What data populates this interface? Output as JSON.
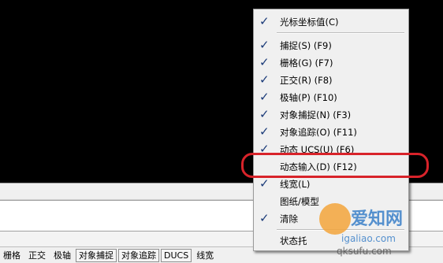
{
  "statusbar": {
    "buttons": [
      {
        "label": "栅格",
        "pressed": false
      },
      {
        "label": "正交",
        "pressed": false
      },
      {
        "label": "极轴",
        "pressed": false
      },
      {
        "label": "对象捕捉",
        "pressed": true
      },
      {
        "label": "对象追踪",
        "pressed": true
      },
      {
        "label": "DUCS",
        "pressed": true
      },
      {
        "label": "线宽",
        "pressed": false
      }
    ]
  },
  "context_menu": {
    "items": [
      {
        "label": "光标坐标值(C)",
        "checked": true
      },
      {
        "label": "捕捉(S) (F9)",
        "checked": true
      },
      {
        "label": "栅格(G) (F7)",
        "checked": true
      },
      {
        "label": "正交(R) (F8)",
        "checked": true
      },
      {
        "label": "极轴(P) (F10)",
        "checked": true
      },
      {
        "label": "对象捕捉(N) (F3)",
        "checked": true
      },
      {
        "label": "对象追踪(O) (F11)",
        "checked": true
      },
      {
        "label": "动态 UCS(U) (F6)",
        "checked": true
      },
      {
        "label": "动态输入(D) (F12)",
        "checked": false
      },
      {
        "label": "线宽(L)",
        "checked": true
      },
      {
        "label": "图纸/模型",
        "checked": false
      },
      {
        "label": "清除",
        "checked": true
      },
      {
        "label": "状态托",
        "checked": false
      }
    ],
    "check_glyph": "✓",
    "highlight_color": "#d8232a"
  },
  "watermark": {
    "brand": "爱知网",
    "url": "igaliao.com",
    "url2": "qksufu.com"
  }
}
